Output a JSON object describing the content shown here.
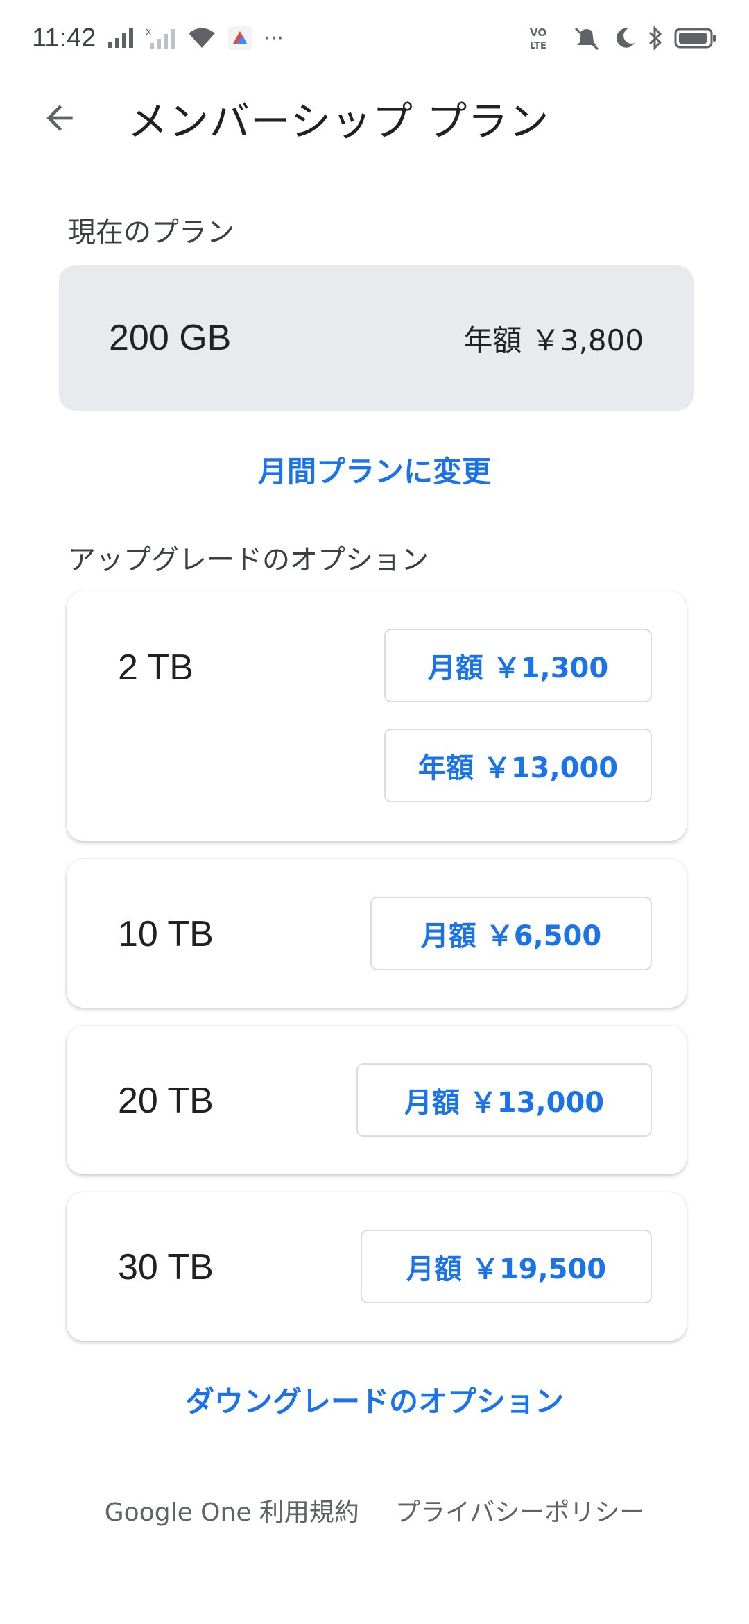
{
  "status_bar": {
    "time": "11:42",
    "icons": [
      "signal-icon",
      "no-signal-icon",
      "wifi-icon",
      "app-notification-icon",
      "more-dots-icon",
      "volte-icon",
      "mute-icon",
      "moon-icon",
      "bluetooth-icon",
      "battery-icon"
    ],
    "more": "···"
  },
  "header": {
    "back_icon": "arrow-back-icon",
    "title": "メンバーシップ プラン"
  },
  "current_plan": {
    "label": "現在のプラン",
    "size": "200 GB",
    "price": "年額 ￥3,800",
    "change_link": "月間プランに変更"
  },
  "upgrade": {
    "label": "アップグレードのオプション",
    "plans": [
      {
        "size": "2 TB",
        "prices": [
          "月額 ￥1,300",
          "年額 ￥13,000"
        ]
      },
      {
        "size": "10 TB",
        "prices": [
          "月額 ￥6,500"
        ]
      },
      {
        "size": "20 TB",
        "prices": [
          "月額 ￥13,000"
        ]
      },
      {
        "size": "30 TB",
        "prices": [
          "月額 ￥19,500"
        ]
      }
    ]
  },
  "downgrade_link": "ダウングレードのオプション",
  "footer": {
    "terms": "Google One 利用規約",
    "privacy": "プライバシーポリシー"
  },
  "colors": {
    "accent": "#1a73e8",
    "current_card_bg": "#e8eaed",
    "text": "#202124",
    "secondary_text": "#5f6368"
  }
}
